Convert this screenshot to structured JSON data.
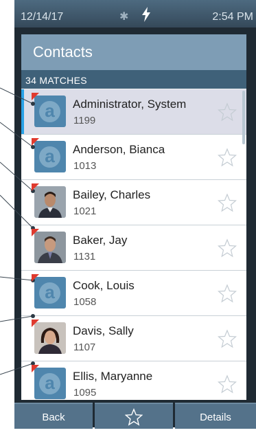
{
  "status_bar": {
    "date": "12/14/17",
    "bluetooth_icon": "bluetooth-icon",
    "charging_icon": "lightning-icon",
    "time": "2:54 PM"
  },
  "header": {
    "title": "Contacts"
  },
  "matches": {
    "label": "34 MATCHES"
  },
  "contacts": [
    {
      "name": "Administrator, System",
      "ext": "1199",
      "avatar": "logo",
      "selected": true
    },
    {
      "name": "Anderson, Bianca",
      "ext": "1013",
      "avatar": "logo",
      "selected": false
    },
    {
      "name": "Bailey, Charles",
      "ext": "1021",
      "avatar": "photo",
      "selected": false
    },
    {
      "name": "Baker, Jay",
      "ext": "1131",
      "avatar": "photo",
      "selected": false
    },
    {
      "name": "Cook, Louis",
      "ext": "1058",
      "avatar": "logo",
      "selected": false
    },
    {
      "name": "Davis, Sally",
      "ext": "1107",
      "avatar": "photo",
      "selected": false
    },
    {
      "name": "Ellis, Maryanne",
      "ext": "1095",
      "avatar": "logo",
      "selected": false
    }
  ],
  "bottom_bar": {
    "back": "Back",
    "favorites_icon": "star-icon",
    "details": "Details"
  },
  "colors": {
    "accent_selected": "#2aa2e6",
    "presence_flag": "#e03a2e",
    "header": "#7e9db5",
    "matches_bar": "#3f6179"
  }
}
